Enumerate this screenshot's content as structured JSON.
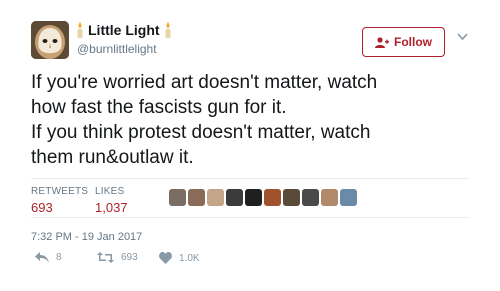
{
  "user": {
    "display_name": "Little Light",
    "handle": "@burnlittlelight"
  },
  "follow_button": {
    "label": "Follow"
  },
  "tweet": {
    "lines": [
      "If you're worried art doesn't matter, watch",
      "how fast the fascists gun for it.",
      "If you think protest doesn't matter, watch",
      "them run&outlaw it."
    ]
  },
  "stats": {
    "retweets_label": "RETWEETS",
    "retweets_value": "693",
    "likes_label": "LIKES",
    "likes_value": "1,037"
  },
  "likers": {
    "colors": [
      "#7a6e64",
      "#8a6a58",
      "#c4a58a",
      "#3b3b3b",
      "#1f1f1f",
      "#a0522d",
      "#5a4a3a",
      "#4a4a4a",
      "#b08a6a",
      "#6a8aa8"
    ]
  },
  "timestamp": "7:32 PM - 19 Jan 2017",
  "actions": {
    "reply_count": "8",
    "retweet_count": "693",
    "like_count": "1.0K"
  },
  "colors": {
    "accent": "#b0202a",
    "muted": "#657786",
    "icon": "#8899a6",
    "divider": "#e6ecf0"
  },
  "icons": {
    "candle": "candle-icon",
    "follow": "add-user-icon",
    "menu": "chevron-down-icon",
    "reply": "reply-icon",
    "retweet": "retweet-icon",
    "like": "heart-icon"
  }
}
